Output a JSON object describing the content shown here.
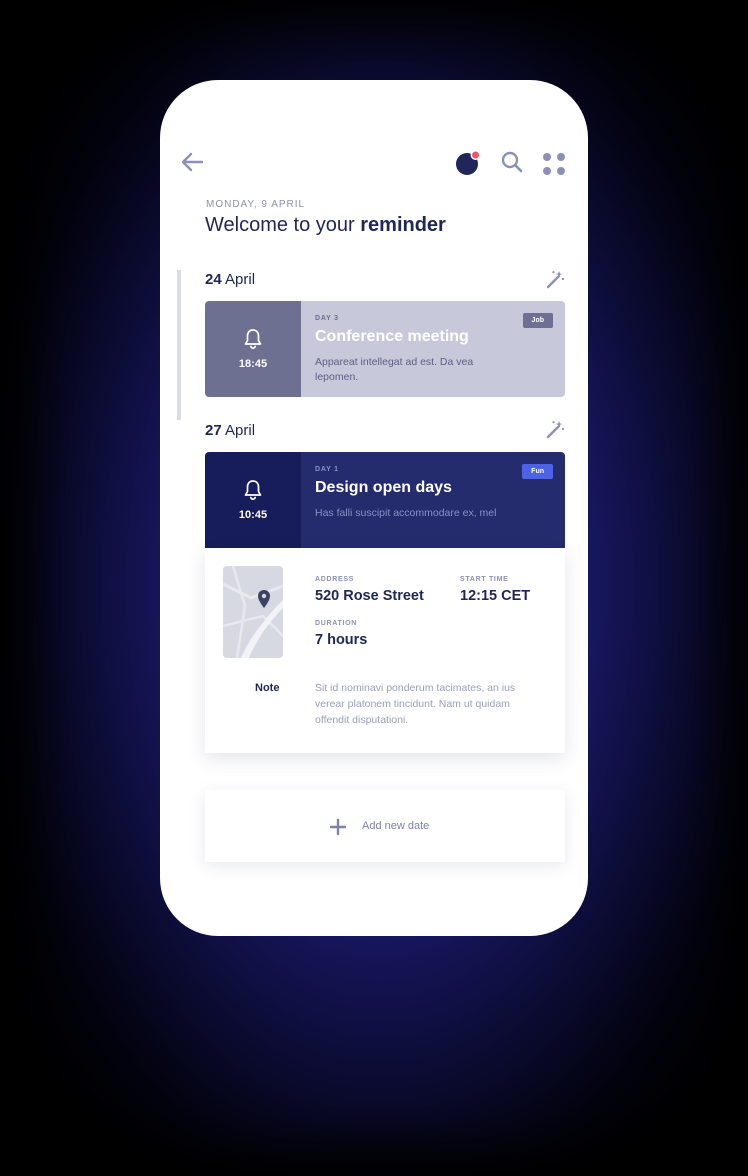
{
  "header": {
    "date_label": "MONDAY, 9 APRIL",
    "welcome_prefix": "Welcome to your ",
    "welcome_bold": "reminder"
  },
  "icons": {
    "back": "arrow-left-icon",
    "avatar": "avatar-icon",
    "search": "search-icon",
    "menu": "grid-menu-icon",
    "edit": "magic-wand-icon",
    "bell": "bell-icon",
    "map": "map-pin-icon",
    "add": "plus-icon"
  },
  "days": [
    {
      "day_num": "24",
      "month": " April",
      "card": {
        "time": "18:45",
        "day_label": "DAY 3",
        "title": "Conference meeting",
        "description": "Appareat intellegat ad est. Da vea lepomen.",
        "tag": "Job"
      }
    },
    {
      "day_num": "27",
      "month": " April",
      "card": {
        "time": "10:45",
        "day_label": "DAY 1",
        "title": "Design open days",
        "description": "Has falli suscipit accommodare ex, mel",
        "tag": "Fun"
      }
    }
  ],
  "details": {
    "address_label": "ADDRESS",
    "address_value": "520 Rose Street",
    "start_label": "START TIME",
    "start_value": "12:15 CET",
    "duration_label": "DURATION",
    "duration_value": "7 hours",
    "note_label": "Note",
    "note_text": "Sit id nominavi ponderum tacimates, an ius verear platonem tincidunt. Nam ut quidam offendit disputationi."
  },
  "add_date": {
    "label": "Add new date"
  },
  "colors": {
    "navy": "#1f2659",
    "accent_dot": "#f0535b",
    "fun_tag": "#4c63e6"
  }
}
